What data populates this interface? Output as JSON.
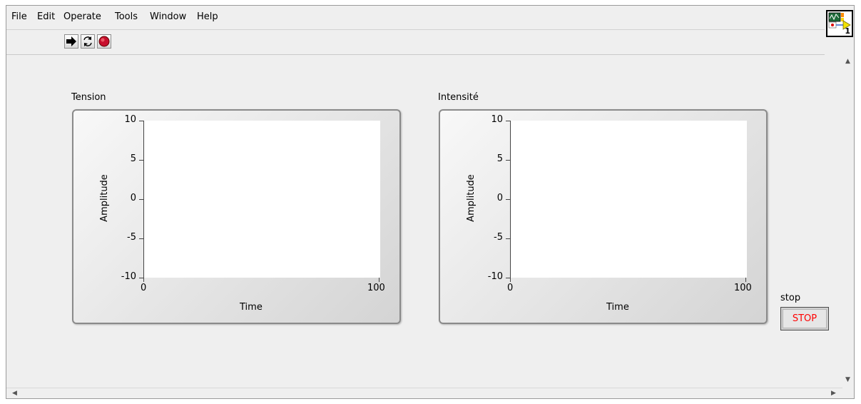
{
  "menu": [
    "File",
    "Edit",
    "Operate",
    "Tools",
    "Window",
    "Help"
  ],
  "icons": {
    "run": "run-arrow-icon",
    "run_continuous": "run-continuously-icon",
    "abort": "abort-execution-icon",
    "vi": "vi-connector-icon"
  },
  "vi_icon": {
    "number": "1"
  },
  "graphs": [
    {
      "label": "Tension",
      "ylabel": "Amplitude",
      "xlabel": "Time",
      "y_ticks": [
        "10",
        "5",
        "0",
        "-5",
        "-10"
      ],
      "x_ticks": [
        "0",
        "100"
      ]
    },
    {
      "label": "Intensité",
      "ylabel": "Amplitude",
      "xlabel": "Time",
      "y_ticks": [
        "10",
        "5",
        "0",
        "-5",
        "-10"
      ],
      "x_ticks": [
        "0",
        "100"
      ]
    }
  ],
  "chart_data": [
    {
      "type": "line",
      "title": "Tension",
      "xlabel": "Time",
      "ylabel": "Amplitude",
      "xlim": [
        0,
        100
      ],
      "ylim": [
        -10,
        10
      ],
      "series": []
    },
    {
      "type": "line",
      "title": "Intensité",
      "xlabel": "Time",
      "ylabel": "Amplitude",
      "xlim": [
        0,
        100
      ],
      "ylim": [
        -10,
        10
      ],
      "series": []
    }
  ],
  "stop_control": {
    "label": "stop",
    "button_text": "STOP",
    "text_color": "#ff0000"
  },
  "colors": {
    "panel_bg": "#efefef",
    "plot_bg": "#ffffff"
  }
}
